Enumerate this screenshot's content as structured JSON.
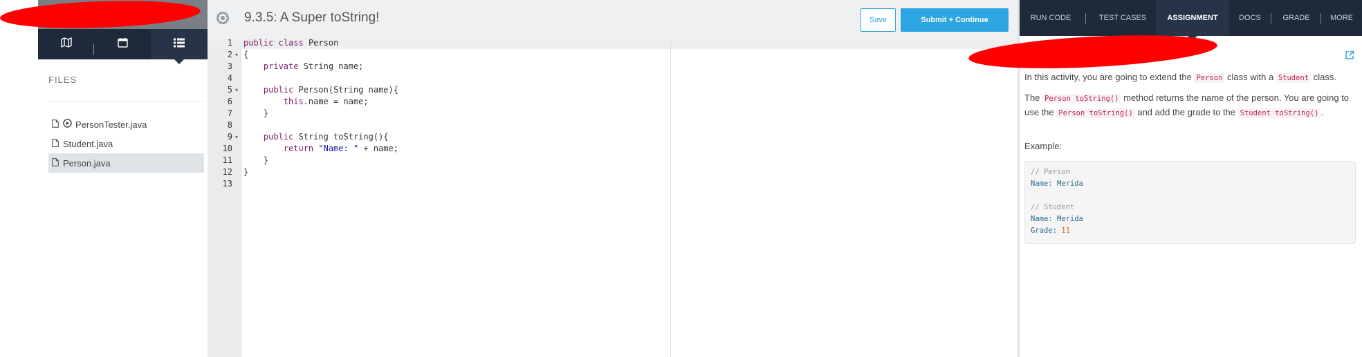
{
  "colors": {
    "accent": "#2ca5e0",
    "nav_dark": "#1e2a3a",
    "nav_active": "#273447",
    "redaction": "#ff0000"
  },
  "sidebar": {
    "tabs": [
      {
        "icon": "map-icon"
      },
      {
        "icon": "calendar-icon"
      },
      {
        "icon": "list-icon",
        "active": true
      }
    ],
    "files_label": "FILES",
    "files": [
      {
        "name": "PersonTester.java",
        "runnable": true
      },
      {
        "name": "Student.java"
      },
      {
        "name": "Person.java",
        "selected": true
      }
    ]
  },
  "header": {
    "settings_icon": "gear-icon",
    "title": "9.3.5: A Super toString!",
    "save_label": "Save",
    "submit_label": "Submit + Continue"
  },
  "editor": {
    "line_numbers": [
      "1",
      "2",
      "3",
      "4",
      "5",
      "6",
      "7",
      "8",
      "9",
      "10",
      "11",
      "12",
      "13"
    ],
    "lines": [
      "public class Person",
      "{",
      "    private String name;",
      "",
      "    public Person(String name){",
      "        this.name = name;",
      "    }",
      "",
      "    public String toString(){",
      "        return \"Name: \" + name;",
      "    }",
      "}",
      ""
    ]
  },
  "right_panel": {
    "tabs": [
      "RUN CODE",
      "TEST CASES",
      "ASSIGNMENT",
      "DOCS",
      "GRADE",
      "MORE"
    ],
    "active_tab": "ASSIGNMENT",
    "intro": {
      "a": "In this activity, you are going to extend the ",
      "code1": "Person",
      "b": " class with a ",
      "code2": "Student",
      "c": " class."
    },
    "para2": {
      "a": "The ",
      "code1": "Person toString()",
      "b": " method returns the name of the person. You are going to use the ",
      "code2": "Person toString()",
      "c": " and add the grade to the ",
      "code3": "Student toString()",
      "d": "."
    },
    "example_label": "Example:",
    "example": {
      "comment1": "// Person",
      "person_key": "Name: ",
      "person_name": "Merida",
      "comment2": "// Student",
      "student_key": "Name: ",
      "student_name": "Merida",
      "grade_key": "Grade: ",
      "grade_value": "11"
    }
  }
}
